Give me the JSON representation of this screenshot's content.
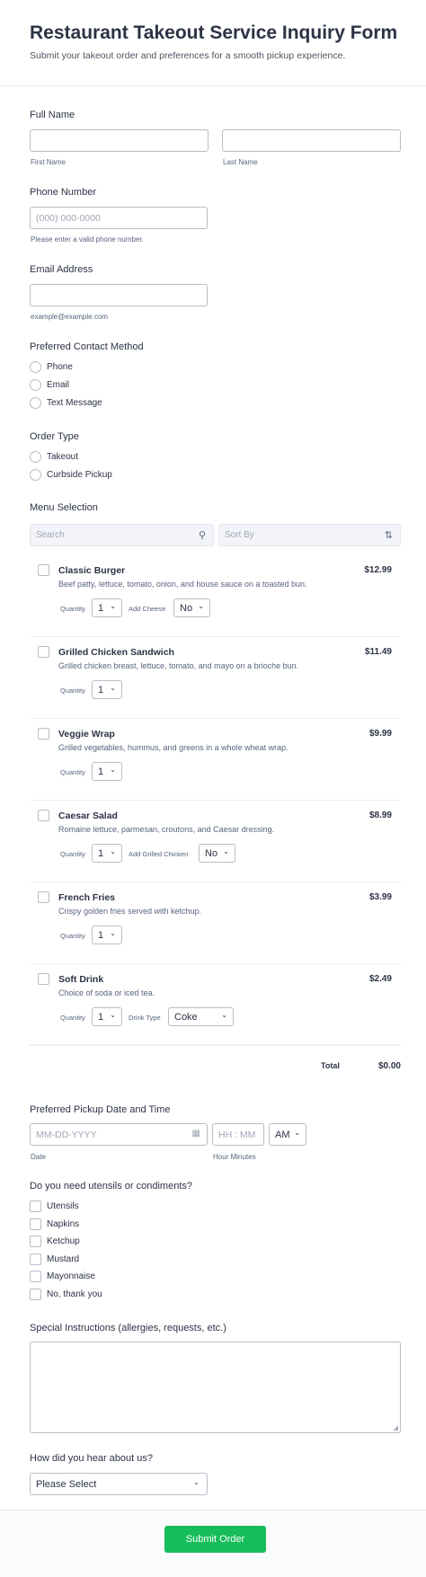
{
  "header": {
    "title": "Restaurant Takeout Service Inquiry Form",
    "subtitle": "Submit your takeout order and preferences for a smooth pickup experience."
  },
  "full_name": {
    "label": "Full Name",
    "first_label": "First Name",
    "last_label": "Last Name",
    "first_value": "",
    "last_value": ""
  },
  "phone": {
    "label": "Phone Number",
    "placeholder": "(000) 000-0000",
    "hint": "Please enter a valid phone number."
  },
  "email": {
    "label": "Email Address",
    "value": "",
    "hint": "example@example.com"
  },
  "contact_method": {
    "label": "Preferred Contact Method",
    "options": [
      "Phone",
      "Email",
      "Text Message"
    ]
  },
  "order_type": {
    "label": "Order Type",
    "options": [
      "Takeout",
      "Curbside Pickup"
    ]
  },
  "menu": {
    "label": "Menu Selection",
    "search_placeholder": "Search",
    "sort_placeholder": "Sort By",
    "quantity_label": "Quantity",
    "items": [
      {
        "name": "Classic Burger",
        "desc": "Beef patty, lettuce, tomato, onion, and house sauce on a toasted bun.",
        "price": "$12.99",
        "qty": "1",
        "extra_label": "Add Cheese",
        "extra_value": "No"
      },
      {
        "name": "Grilled Chicken Sandwich",
        "desc": "Grilled chicken breast, lettuce, tomato, and mayo on a brioche bun.",
        "price": "$11.49",
        "qty": "1"
      },
      {
        "name": "Veggie Wrap",
        "desc": "Grilled vegetables, hummus, and greens in a whole wheat wrap.",
        "price": "$9.99",
        "qty": "1"
      },
      {
        "name": "Caesar Salad",
        "desc": "Romaine lettuce, parmesan, croutons, and Caesar dressing.",
        "price": "$8.99",
        "qty": "1",
        "extra_label": "Add Grilled Chicken",
        "extra_value": "No"
      },
      {
        "name": "French Fries",
        "desc": "Crispy golden fries served with ketchup.",
        "price": "$3.99",
        "qty": "1"
      },
      {
        "name": "Soft Drink",
        "desc": "Choice of soda or iced tea.",
        "price": "$2.49",
        "qty": "1",
        "extra_label": "Drink Type",
        "extra_value": "Coke"
      }
    ],
    "total_label": "Total",
    "total_value": "$0.00"
  },
  "pickup": {
    "label": "Preferred Pickup Date and Time",
    "date_placeholder": "MM-DD-YYYY",
    "time_placeholder": "HH : MM",
    "ampm": "AM",
    "date_label": "Date",
    "time_label": "Hour Minutes"
  },
  "utensils": {
    "label": "Do you need utensils or condiments?",
    "options": [
      "Utensils",
      "Napkins",
      "Ketchup",
      "Mustard",
      "Mayonnaise",
      "No, thank you"
    ]
  },
  "instructions": {
    "label": "Special Instructions (allergies, requests, etc.)",
    "value": ""
  },
  "referral": {
    "label": "How did you hear about us?",
    "selected": "Please Select"
  },
  "submit_label": "Submit Order",
  "colors": {
    "accent": "#18bd5b",
    "text": "#2c3345",
    "border": "#b8bdc9"
  },
  "icons": {
    "search": "search-icon",
    "sort": "sort-icon",
    "calendar": "calendar-icon",
    "chevron": "chevron-down-icon"
  }
}
